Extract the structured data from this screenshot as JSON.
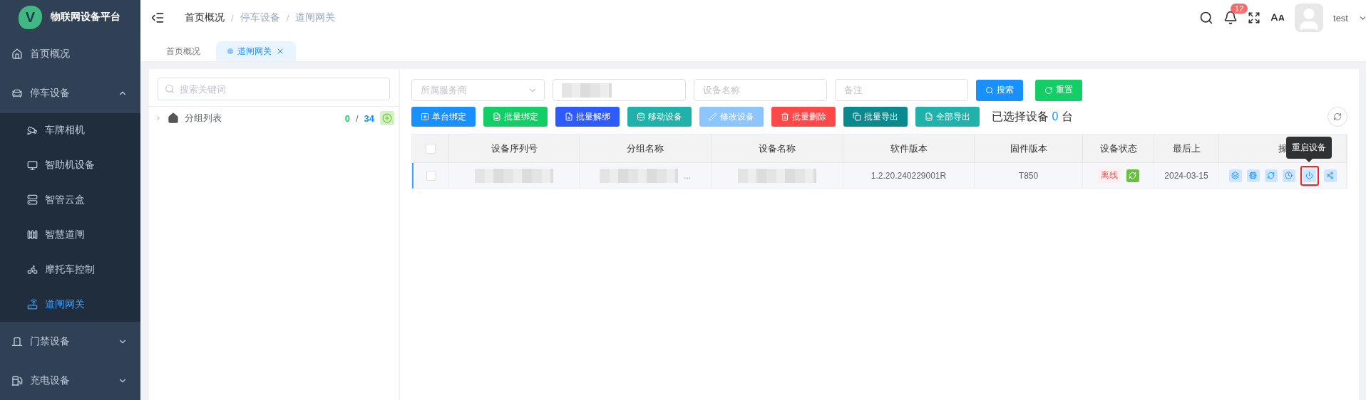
{
  "app": {
    "title": "物联网设备平台",
    "logo_letter": "V"
  },
  "sidebar": {
    "items": [
      {
        "label": "首页概况",
        "kind": "link",
        "selected": false
      },
      {
        "label": "停车设备",
        "kind": "group",
        "expanded": true,
        "children": [
          {
            "label": "车牌相机",
            "selected": false
          },
          {
            "label": "智助机设备",
            "selected": false
          },
          {
            "label": "智管云盒",
            "selected": false
          },
          {
            "label": "智慧道闸",
            "selected": false
          },
          {
            "label": "摩托车控制",
            "selected": false
          },
          {
            "label": "道闸网关",
            "selected": true
          }
        ]
      },
      {
        "label": "门禁设备",
        "kind": "group",
        "expanded": false
      },
      {
        "label": "充电设备",
        "kind": "group",
        "expanded": false
      }
    ]
  },
  "breadcrumb": [
    {
      "label": "首页概况",
      "link": true
    },
    {
      "separator": "/",
      "label": "停车设备",
      "link": false
    },
    {
      "separator": "/",
      "label": "道闸网关",
      "link": false
    }
  ],
  "header": {
    "notification_count": "12",
    "user": "test"
  },
  "tabs": [
    {
      "label": "首页概况",
      "selected": false,
      "closable": false
    },
    {
      "label": "道闸网关",
      "selected": true,
      "closable": true
    }
  ],
  "tree": {
    "search_placeholder": "搜索关键词",
    "root": {
      "label": "分组列表",
      "expanded": false,
      "selected_count": "0",
      "count_separator": "/",
      "total_count": "34"
    }
  },
  "filters": [
    {
      "kind": "select",
      "placeholder": "所属服务商"
    },
    {
      "kind": "blurred"
    },
    {
      "kind": "input",
      "placeholder": "设备名称"
    },
    {
      "kind": "input",
      "placeholder": "备注"
    }
  ],
  "filter_buttons": [
    {
      "label": "搜索",
      "kind": "search",
      "color": "#1890ff"
    },
    {
      "label": "重置",
      "kind": "reset",
      "color": "#13ce66"
    }
  ],
  "actions": [
    {
      "label": "单台绑定",
      "color": "#1890ff"
    },
    {
      "label": "批量绑定",
      "color": "#13ce66"
    },
    {
      "label": "批量解绑",
      "color": "#2d5bff"
    },
    {
      "label": "移动设备",
      "color": "#20b2aa"
    },
    {
      "label": "修改设备",
      "color": "#8cc5ff"
    },
    {
      "label": "批量删除",
      "color": "#ff4949"
    },
    {
      "label": "批量导出",
      "color": "#0a8a8f"
    },
    {
      "label": "全部导出",
      "color": "#20b2aa"
    }
  ],
  "selection": {
    "prefix": "已选择设备",
    "count": "0",
    "suffix": "台"
  },
  "table": {
    "all_checked": false,
    "columns": [
      "设备序列号",
      "分组名称",
      "设备名称",
      "软件版本",
      "固件版本",
      "设备状态",
      "最后上",
      "操"
    ],
    "rows": [
      {
        "checked": false,
        "current": true,
        "serial": {
          "kind": "blurred"
        },
        "group": {
          "kind": "blurred",
          "tail": "..."
        },
        "name": {
          "kind": "blurred"
        },
        "software": "1.2.20.240229001R",
        "firmware": "T850",
        "status": {
          "label": "离线",
          "online": false
        },
        "last_seen": "2024-03-15",
        "operations": [
          {
            "highlighted": false
          },
          {
            "highlighted": false
          },
          {
            "highlighted": false
          },
          {
            "highlighted": false
          },
          {
            "highlighted": true
          },
          {
            "highlighted": false
          }
        ]
      }
    ]
  },
  "tooltip": "重启设备"
}
